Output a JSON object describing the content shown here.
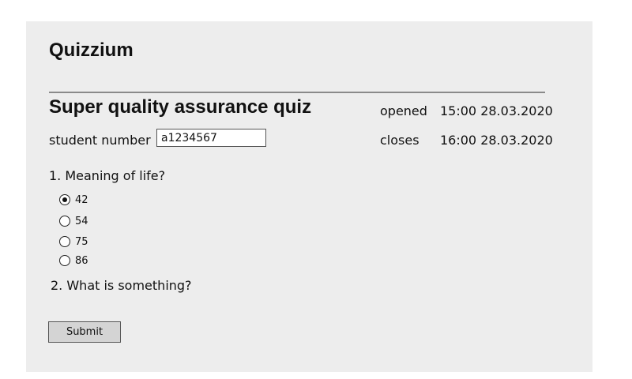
{
  "app": {
    "title": "Quizzium"
  },
  "quiz": {
    "title": "Super quality assurance quiz",
    "opened_label": "opened",
    "opened_value": "15:00 28.03.2020",
    "closes_label": "closes",
    "closes_value": "16:00 28.03.2020"
  },
  "student": {
    "label": "student number",
    "value": "a1234567"
  },
  "questions": [
    {
      "text": "1. Meaning of life?",
      "options": [
        {
          "label": "42",
          "selected": true
        },
        {
          "label": "54",
          "selected": false
        },
        {
          "label": "75",
          "selected": false
        },
        {
          "label": "86",
          "selected": false
        }
      ]
    },
    {
      "text": "2. What is something?"
    }
  ],
  "actions": {
    "submit_label": "Submit"
  }
}
